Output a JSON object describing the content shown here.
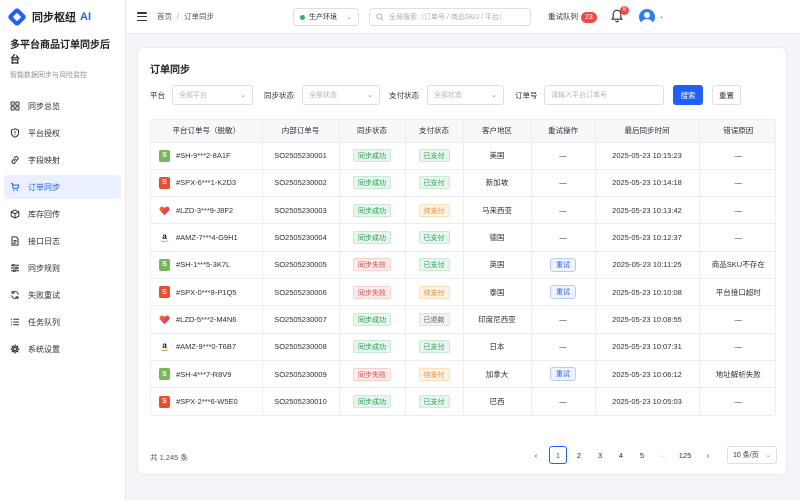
{
  "brand": {
    "name": "同步枢纽",
    "ai": "AI",
    "title": "多平台商品订单同步后台",
    "subtitle": "智能数据同步与风险监控"
  },
  "nav": [
    {
      "label": "同步总览",
      "icon": "grid-icon",
      "active": false
    },
    {
      "label": "平台授权",
      "icon": "shield-icon",
      "active": false
    },
    {
      "label": "字段映射",
      "icon": "link-icon",
      "active": false
    },
    {
      "label": "订单同步",
      "icon": "cart-icon",
      "active": true
    },
    {
      "label": "库存回传",
      "icon": "box-icon",
      "active": false
    },
    {
      "label": "接口日志",
      "icon": "document-icon",
      "active": false
    },
    {
      "label": "同步规则",
      "icon": "sliders-icon",
      "active": false
    },
    {
      "label": "失败重试",
      "icon": "refresh-icon",
      "active": false
    },
    {
      "label": "任务队列",
      "icon": "list-icon",
      "active": false
    },
    {
      "label": "系统设置",
      "icon": "gear-icon",
      "active": false
    }
  ],
  "topbar": {
    "breadcrumb": [
      "首页",
      "订单同步"
    ],
    "breadcrumb_sep": "/",
    "env": "生产环境",
    "search_placeholder": "全局搜索（订单号 / 商品SKU / 平台）",
    "retry_queue_label": "重试队列",
    "retry_queue_count": "23",
    "notifications_count": "8"
  },
  "page": {
    "title": "订单同步",
    "filters": {
      "platform_label": "平台",
      "platform_placeholder": "全部平台",
      "sync_label": "同步状态",
      "sync_placeholder": "全部状态",
      "pay_label": "支付状态",
      "pay_placeholder": "全部状态",
      "order_label": "订单号",
      "order_placeholder": "请输入平台订单号",
      "search_btn": "搜索",
      "reset_btn": "重置"
    },
    "columns": [
      "平台订单号（脱敏）",
      "内部订单号",
      "同步状态",
      "支付状态",
      "客户地区",
      "重试操作",
      "最后同步时间",
      "错误原因"
    ],
    "rows": [
      {
        "platform": "shopify",
        "order": "#SH-9***2-8A1F",
        "internal": "SO2505230001",
        "sync": "同步成功",
        "sync_tone": "green",
        "pay": "已支付",
        "pay_tone": "green",
        "region": "美国",
        "retry": "—",
        "retry_btn": false,
        "time": "2025-05-23 10:15:23",
        "error": "—"
      },
      {
        "platform": "shopee",
        "order": "#SPX-6***1-K2D3",
        "internal": "SO2505230002",
        "sync": "同步成功",
        "sync_tone": "green",
        "pay": "已支付",
        "pay_tone": "green",
        "region": "新加坡",
        "retry": "—",
        "retry_btn": false,
        "time": "2025-05-23 10:14:18",
        "error": "—"
      },
      {
        "platform": "lazada",
        "order": "#LZD-3***9-J8F2",
        "internal": "SO2505230003",
        "sync": "同步成功",
        "sync_tone": "green",
        "pay": "待支付",
        "pay_tone": "orange",
        "region": "马来西亚",
        "retry": "—",
        "retry_btn": false,
        "time": "2025-05-23 10:13:42",
        "error": "—"
      },
      {
        "platform": "amazon",
        "order": "#AMZ-7***4-G9H1",
        "internal": "SO2505230004",
        "sync": "同步成功",
        "sync_tone": "green",
        "pay": "已支付",
        "pay_tone": "green",
        "region": "德国",
        "retry": "—",
        "retry_btn": false,
        "time": "2025-05-23 10:12:37",
        "error": "—"
      },
      {
        "platform": "shopify",
        "order": "#SH-1***5-3K7L",
        "internal": "SO2505230005",
        "sync": "同步失败",
        "sync_tone": "red",
        "pay": "已支付",
        "pay_tone": "green",
        "region": "英国",
        "retry": "重试",
        "retry_btn": true,
        "time": "2025-05-23 10:11:25",
        "error": "商品SKU不存在"
      },
      {
        "platform": "shopee",
        "order": "#SPX-0***8-P1Q5",
        "internal": "SO2505230006",
        "sync": "同步失败",
        "sync_tone": "red",
        "pay": "待支付",
        "pay_tone": "orange",
        "region": "泰国",
        "retry": "重试",
        "retry_btn": true,
        "time": "2025-05-23 10:10:08",
        "error": "平台接口超时"
      },
      {
        "platform": "lazada",
        "order": "#LZD-5***2-M4N6",
        "internal": "SO2505230007",
        "sync": "同步成功",
        "sync_tone": "green",
        "pay": "已退款",
        "pay_tone": "gray",
        "region": "印度尼西亚",
        "retry": "—",
        "retry_btn": false,
        "time": "2025-05-23 10:08:55",
        "error": "—"
      },
      {
        "platform": "amazon",
        "order": "#AMZ-9***0-T6B7",
        "internal": "SO2505230008",
        "sync": "同步成功",
        "sync_tone": "green",
        "pay": "已支付",
        "pay_tone": "green",
        "region": "日本",
        "retry": "—",
        "retry_btn": false,
        "time": "2025-05-23 10:07:31",
        "error": "—"
      },
      {
        "platform": "shopify",
        "order": "#SH-4***7-R8V9",
        "internal": "SO2505230009",
        "sync": "同步失败",
        "sync_tone": "red",
        "pay": "待支付",
        "pay_tone": "orange",
        "region": "加拿大",
        "retry": "重试",
        "retry_btn": true,
        "time": "2025-05-23 10:06:12",
        "error": "地址解析失败"
      },
      {
        "platform": "shopee",
        "order": "#SPX-2***6-W5E0",
        "internal": "SO2505230010",
        "sync": "同步成功",
        "sync_tone": "green",
        "pay": "已支付",
        "pay_tone": "green",
        "region": "巴西",
        "retry": "—",
        "retry_btn": false,
        "time": "2025-05-23 10:05:03",
        "error": "—"
      }
    ],
    "total": "共 1,245 条",
    "pagination": {
      "prev": "‹",
      "pages": [
        "1",
        "2",
        "3",
        "4",
        "5"
      ],
      "ellipsis": "···",
      "last": "125",
      "next": "›",
      "current": "1",
      "page_size": "10 条/页"
    }
  },
  "colors": {
    "primary": "#1f5eff",
    "success": "#2a9d50",
    "danger": "#e04545",
    "warning": "#f08a24"
  }
}
